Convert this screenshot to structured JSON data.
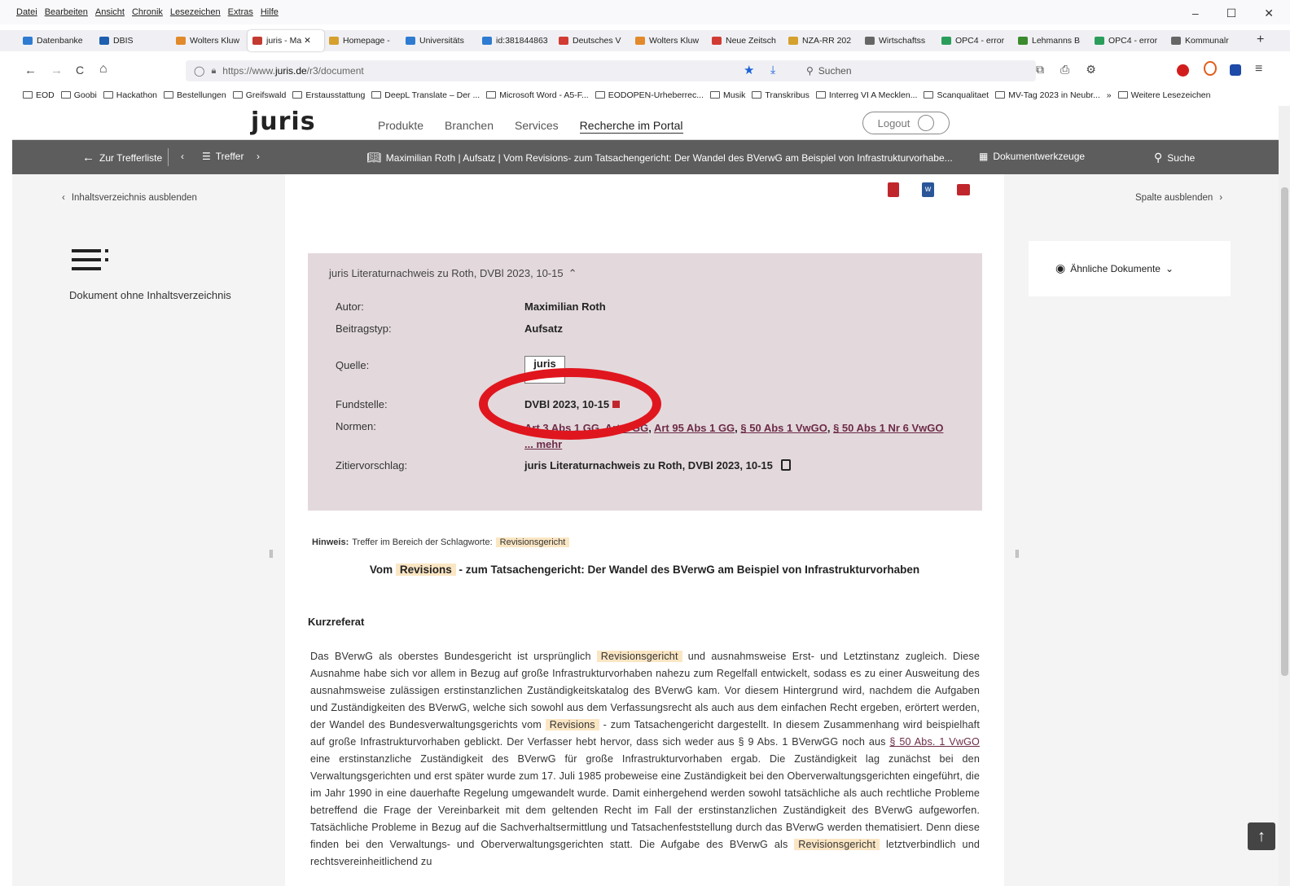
{
  "menu": [
    "Datei",
    "Bearbeiten",
    "Ansicht",
    "Chronik",
    "Lesezeichen",
    "Extras",
    "Hilfe"
  ],
  "window_controls": [
    "–",
    "☐",
    "✕"
  ],
  "tabs": [
    {
      "label": "Datenbanke",
      "color": "#2e7bd1"
    },
    {
      "label": "DBIS",
      "color": "#1f5fb0"
    },
    {
      "label": "Wolters Kluw",
      "color": "#e2892b"
    },
    {
      "label": "juris - Ma ✕",
      "color": "#c43a31"
    },
    {
      "label": "Homepage -",
      "color": "#d5a02e"
    },
    {
      "label": "Universitäts",
      "color": "#2e7bd1"
    },
    {
      "label": "id:381844863",
      "color": "#2e7bd1"
    },
    {
      "label": "Deutsches V",
      "color": "#d23b33"
    },
    {
      "label": "Wolters Kluw",
      "color": "#e2892b"
    },
    {
      "label": "Neue Zeitsch",
      "color": "#d23b33"
    },
    {
      "label": "NZA-RR 202",
      "color": "#d5a02e"
    },
    {
      "label": "Wirtschaftss",
      "color": "#666666"
    },
    {
      "label": "OPC4 - error",
      "color": "#2a9d5b"
    },
    {
      "label": "Lehmanns B",
      "color": "#3b8a2d"
    },
    {
      "label": "OPC4 - error",
      "color": "#2a9d5b"
    },
    {
      "label": "Kommunalr",
      "color": "#666666"
    }
  ],
  "new_tab": "+",
  "nav": {
    "back": "←",
    "forward": "→",
    "reload": "C",
    "home": "⌂"
  },
  "url": {
    "prefix": "https://www.",
    "domain": "juris.de",
    "path": "/r3/document"
  },
  "search": {
    "placeholder": "Suchen"
  },
  "bookmarks": [
    "EOD",
    "Goobi",
    "Hackathon",
    "Bestellungen",
    "Greifswald",
    "Erstausstattung",
    "DeepL Translate – Der ...",
    "Microsoft Word - A5-F...",
    "EODOPEN-Urheberrec...",
    "Musik",
    "Transkribus",
    "Interreg VI A Mecklen...",
    "Scanqualitaet",
    "MV-Tag 2023 in Neubr...",
    "»",
    "Weitere Lesezeichen"
  ],
  "site": {
    "logo": "juris",
    "nav": [
      "Produkte",
      "Branchen",
      "Services",
      "Recherche im Portal"
    ],
    "logout": "Logout"
  },
  "doc_toolbar": {
    "back": "Zur Trefferliste",
    "treffer": "Treffer",
    "title": "Maximilian Roth | Aufsatz | Vom Revisions- zum Tatsachengericht: Der Wandel des BVerwG am Beispiel von Infrastrukturvorhabe...",
    "tools": "Dokumentwerkzeuge",
    "search": "Suche"
  },
  "left": {
    "hide_toc": "Inhaltsverzeichnis ausblenden",
    "no_toc": "Dokument ohne Inhaltsverzeichnis"
  },
  "right": {
    "hide_col": "Spalte ausblenden",
    "similar": "Ähnliche Dokumente"
  },
  "lit": {
    "heading": "juris Literaturnachweis zu Roth, DVBl 2023, 10-15",
    "rows": [
      {
        "label": "Autor:",
        "value": "Maximilian Roth"
      },
      {
        "label": "Beitragstyp:",
        "value": "Aufsatz"
      },
      {
        "label": "Quelle:",
        "value": "juris"
      },
      {
        "label": "Fundstelle:",
        "value": "DVBl 2023, 10-15"
      },
      {
        "label": "Normen:",
        "value": ""
      },
      {
        "label": "Zitiervorschlag:",
        "value": "juris Literaturnachweis zu Roth, DVBl 2023, 10-15"
      }
    ],
    "normen": [
      "Art 3 Abs 1 GG",
      "Art 2 GG",
      "Art 95 Abs 1 GG",
      "§ 50 Abs 1 VwGO",
      "§ 50 Abs 1 Nr 6 VwGO"
    ],
    "mehr": "... mehr"
  },
  "hinweis": {
    "label": "Hinweis:",
    "text": "Treffer im Bereich der Schlagworte:",
    "term": "Revisionsgericht"
  },
  "article": {
    "title_pre": "Vom",
    "title_hl": "Revisions",
    "title_post": "- zum Tatsachengericht: Der Wandel des BVerwG am Beispiel von Infrastrukturvorhaben",
    "section": "Kurzreferat",
    "p1": "Das BVerwG als oberstes Bundesgericht ist ursprünglich",
    "hl1": "Revisionsgericht",
    "p2": "und ausnahmsweise Erst- und Letztinstanz zugleich. Diese Ausnahme habe sich vor allem in Bezug auf große Infrastrukturvorhaben nahezu zum Regelfall entwickelt, sodass es zu einer Ausweitung des ausnahmsweise zulässigen erstinstanzlichen Zuständigkeitskatalog des BVerwG kam. Vor diesem Hintergrund wird, nachdem die Aufgaben und Zuständigkeiten des BVerwG, welche sich sowohl aus dem Verfassungsrecht als auch aus dem einfachen Recht ergeben, erörtert werden, der Wandel des Bundesverwaltungsgerichts vom",
    "hl2": "Revisions",
    "p3": "- zum Tatsachengericht dargestellt. In diesem Zusammenhang wird beispielhaft auf große Infrastrukturvorhaben geblickt. Der Verfasser hebt hervor, dass sich weder aus § 9 Abs. 1 BVerwGG noch aus",
    "link": "§ 50 Abs. 1 VwGO",
    "p4": "eine erstinstanzliche Zuständigkeit des BVerwG für große Infrastrukturvorhaben ergab. Die Zuständigkeit lag zunächst bei den Verwaltungsgerichten und erst später wurde zum 17. Juli 1985 probeweise eine Zuständigkeit bei den Oberverwaltungsgerichten eingeführt, die im Jahr 1990 in eine dauerhafte Regelung umgewandelt wurde. Damit einhergehend werden sowohl tatsächliche als auch rechtliche Probleme betreffend die Frage der Vereinbarkeit mit dem geltenden Recht im Fall der erstinstanzlichen Zuständigkeit des BVerwG aufgeworfen. Tatsächliche Probleme in Bezug auf die Sachverhaltsermittlung und Tatsachenfeststellung durch das BVerwG werden thematisiert. Denn diese finden bei den Verwaltungs- und Oberverwaltungsgerichten statt. Die Aufgabe des BVerwG als",
    "hl3": "Revisionsgericht",
    "p5": "letztverbindlich und rechtsvereinheitlichend zu"
  },
  "colors": {
    "toolbar": "#5d5d5d",
    "lit_bg": "#e3d9dc",
    "highlight": "#fbe6c4",
    "link": "#6d2b47",
    "annotation": "#e0161e"
  }
}
